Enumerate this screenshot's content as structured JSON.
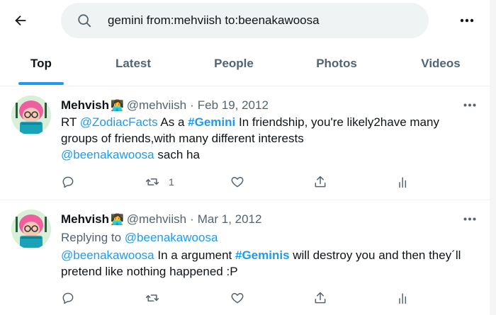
{
  "search": {
    "query": "gemini from:mehviish to:beenakawoosa"
  },
  "tabs": [
    "Top",
    "Latest",
    "People",
    "Photos",
    "Videos"
  ],
  "active_tab": "Top",
  "colors": {
    "accent": "#1d9bf0",
    "secondary_text": "#536471",
    "search_bg": "#eff3f4"
  },
  "icons": {
    "back": "arrow-left-icon",
    "search": "search-icon",
    "more": "more-horizontal-icon",
    "reply": "reply-icon",
    "retweet": "retweet-icon",
    "like": "heart-icon",
    "share": "share-icon",
    "analytics": "analytics-icon"
  },
  "tweets": [
    {
      "name": "Mehvish",
      "emoji": "👩‍💻",
      "handle": "@mehviish",
      "dot": "·",
      "date": "Feb 19, 2012",
      "text": {
        "rt": "RT ",
        "mention1": "@ZodiacFacts",
        "t1": " As a ",
        "hashtag": "#Gemini",
        "t2": " In friendship, you're likely2have many groups of friends,with many different interests ",
        "mention2": "@beenakawoosa",
        "t3": " sach ha"
      },
      "retweet_count": "1"
    },
    {
      "name": "Mehvish",
      "emoji": "👩‍💻",
      "handle": "@mehviish",
      "dot": "·",
      "date": "Mar 1, 2012",
      "replying_label": "Replying to ",
      "replying_to": "@beenakawoosa",
      "text": {
        "mention": "@beenakawoosa",
        "t1": " In a argument ",
        "hashtag": "#Geminis",
        "t2": " will destroy you and then they´ll pretend like nothing happened :P"
      },
      "retweet_count": ""
    }
  ]
}
